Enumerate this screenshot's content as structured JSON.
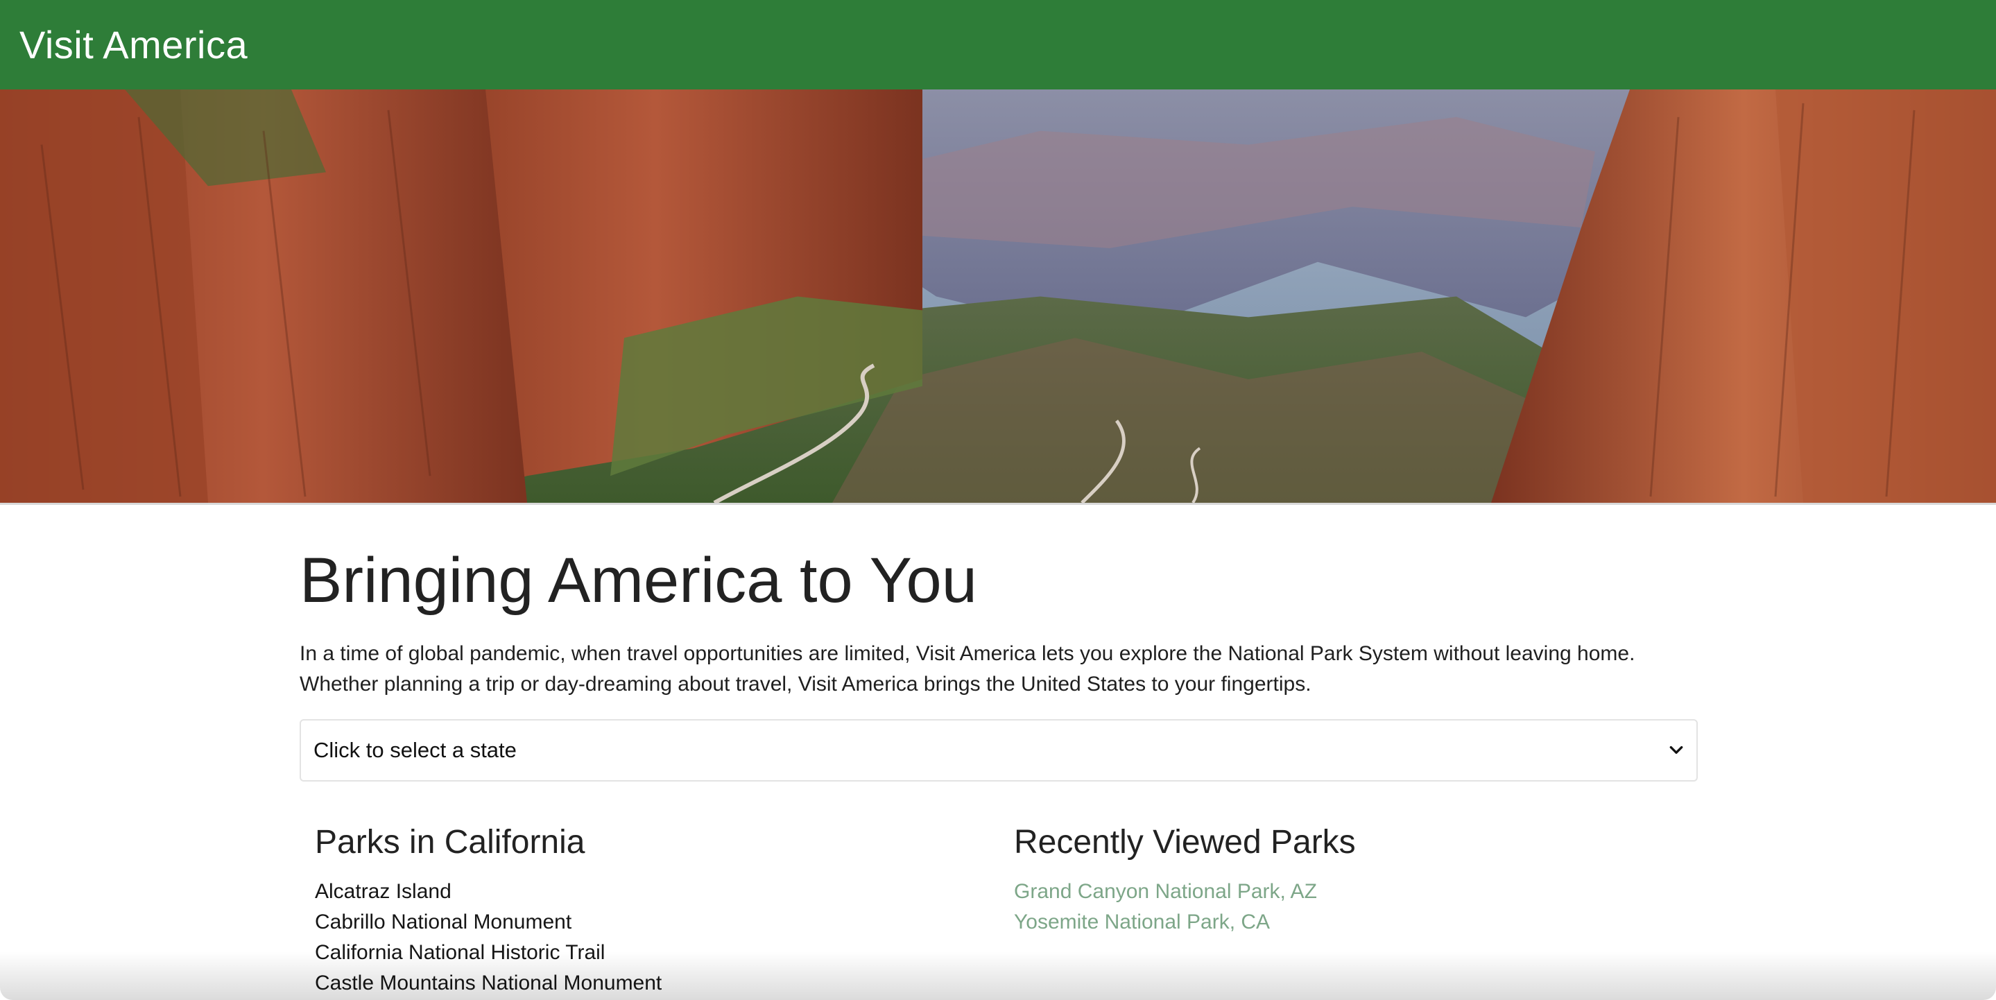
{
  "navbar": {
    "brand": "Visit America",
    "background": "#2e7d38"
  },
  "hero": {
    "image_label": "canyon-landscape"
  },
  "main": {
    "title": "Bringing America to You",
    "intro": "In a time of global pandemic, when travel opportunities are limited, Visit America lets you explore the National Park System without leaving home. Whether planning a trip or day-dreaming about travel, Visit America brings the United States to your fingertips.",
    "state_select": {
      "selected": "Click to select a state"
    }
  },
  "parks": {
    "title": "Parks in California",
    "items": [
      "Alcatraz Island",
      "Cabrillo National Monument",
      "California National Historic Trail",
      "Castle Mountains National Monument"
    ]
  },
  "recent": {
    "title": "Recently Viewed Parks",
    "items": [
      "Grand Canyon National Park, AZ",
      "Yosemite National Park, CA"
    ],
    "link_color": "#7da688"
  }
}
